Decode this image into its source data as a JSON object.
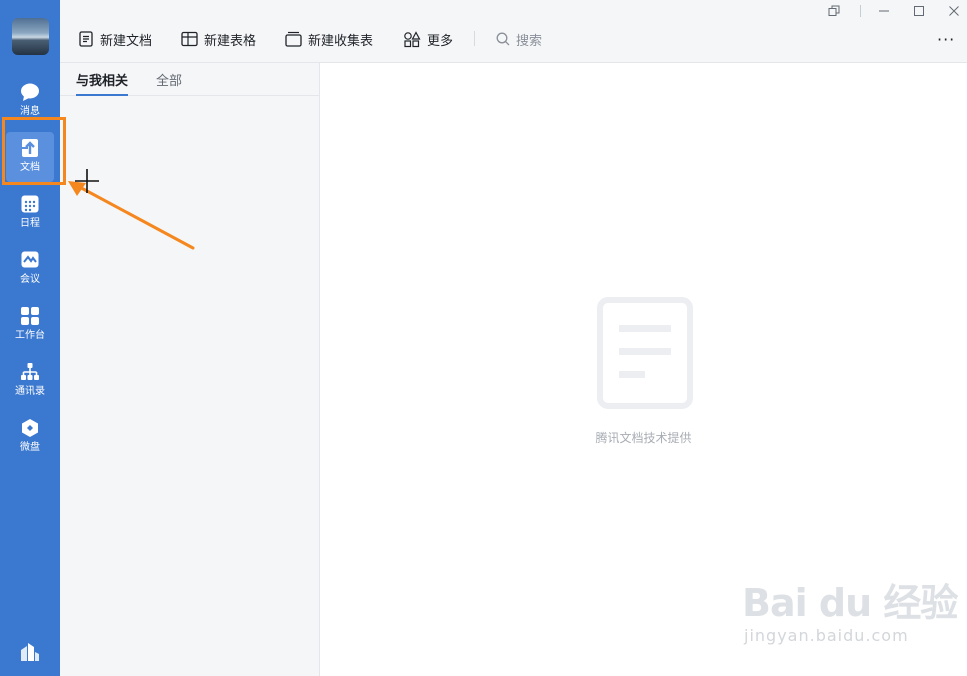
{
  "sidebar": {
    "items": [
      {
        "label": "消息",
        "icon": "chat-bubble-icon"
      },
      {
        "label": "文档",
        "icon": "document-icon"
      },
      {
        "label": "日程",
        "icon": "calendar-icon"
      },
      {
        "label": "会议",
        "icon": "meeting-icon"
      },
      {
        "label": "工作台",
        "icon": "apps-grid-icon"
      },
      {
        "label": "通讯录",
        "icon": "org-chart-icon"
      },
      {
        "label": "微盘",
        "icon": "cloud-drive-icon"
      }
    ],
    "active_index": 1,
    "bottom_icon": "building-icon"
  },
  "toolbar": {
    "new_doc": "新建文档",
    "new_sheet": "新建表格",
    "new_form": "新建收集表",
    "more": "更多",
    "search_placeholder": "搜索",
    "overflow": "···"
  },
  "tabs": [
    {
      "label": "与我相关",
      "active": true
    },
    {
      "label": "全部",
      "active": false
    }
  ],
  "main": {
    "empty_caption": "腾讯文档技术提供"
  },
  "watermark": {
    "brand": "Bai du 经验",
    "url": "jingyan.baidu.com"
  },
  "colors": {
    "sidebar": "#3b78cf",
    "highlight": "#f5871f",
    "accent": "#3b78cf"
  }
}
